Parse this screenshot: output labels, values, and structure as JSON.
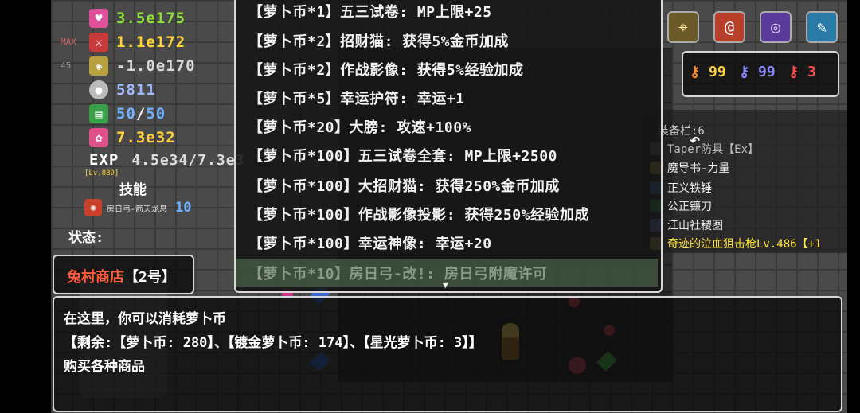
{
  "stats": {
    "hp": "3.5e175",
    "atk": "1.1e172",
    "def": "-1.0e170",
    "mdef": "5811",
    "mp_current": "50",
    "mp_max": "50",
    "gold": "7.3e32",
    "exp_label": "EXP",
    "exp_value": "4.5e34/7.3e3",
    "level": "[Lv.889]",
    "max_tag": "MAX",
    "side_num": "45",
    "skill_title": "技能",
    "skill_name": "房日弓-箭天龙息",
    "skill_level": "10",
    "status_label": "状态:"
  },
  "shop": {
    "title": "兔村商店",
    "number": "【2号】"
  },
  "menu": {
    "items": [
      "【萝卜币*1】五三试卷: MP上限+25",
      "【萝卜币*2】招财猫: 获得5%金币加成",
      "【萝卜币*2】作战影像: 获得5%经验加成",
      "【萝卜币*5】幸运护符: 幸运+1",
      "【萝卜币*20】大膀: 攻速+100%",
      "【萝卜币*100】五三试卷全套: MP上限+2500",
      "【萝卜币*100】大招财猫: 获得250%金币加成",
      "【萝卜币*100】作战影像投影: 获得250%经验加成",
      "【萝卜币*100】幸运神像: 幸运+20",
      "【萝卜币*10】房日弓-改!: 房日弓附魔许可"
    ],
    "more_arrow": "▼"
  },
  "keys": {
    "orange": "99",
    "blue": "99",
    "red": "3"
  },
  "equipment": {
    "title": "装备栏:6",
    "items": [
      "Taper防具【Ex】",
      "魔导书-力量",
      "正义铁锤",
      "公正镰刀",
      "江山社稷图",
      "奇迹的泣血狙击枪Lv.486【+1"
    ]
  },
  "dialog": {
    "line1": "在这里，你可以消耗萝卜币",
    "line2": "【剩余:【萝卜币: 280】、【镀金萝卜币: 174】、【星光萝卜币: 3】】",
    "line3": "购买各种商品"
  },
  "colors": {
    "hp": "#8de03a",
    "atk": "#ffd23a",
    "def": "#d8d8d8",
    "mdef": "#9fb8ff",
    "mp": "#6fb0ff",
    "gold": "#ffd23a",
    "shop_title": "#ff5a3a",
    "equip_last": "#ffe23a"
  },
  "icons": [
    "heart-icon",
    "sword-icon",
    "shield-icon",
    "orb-icon",
    "book-icon",
    "flame-icon",
    "key-icon",
    "dragon-icon"
  ]
}
